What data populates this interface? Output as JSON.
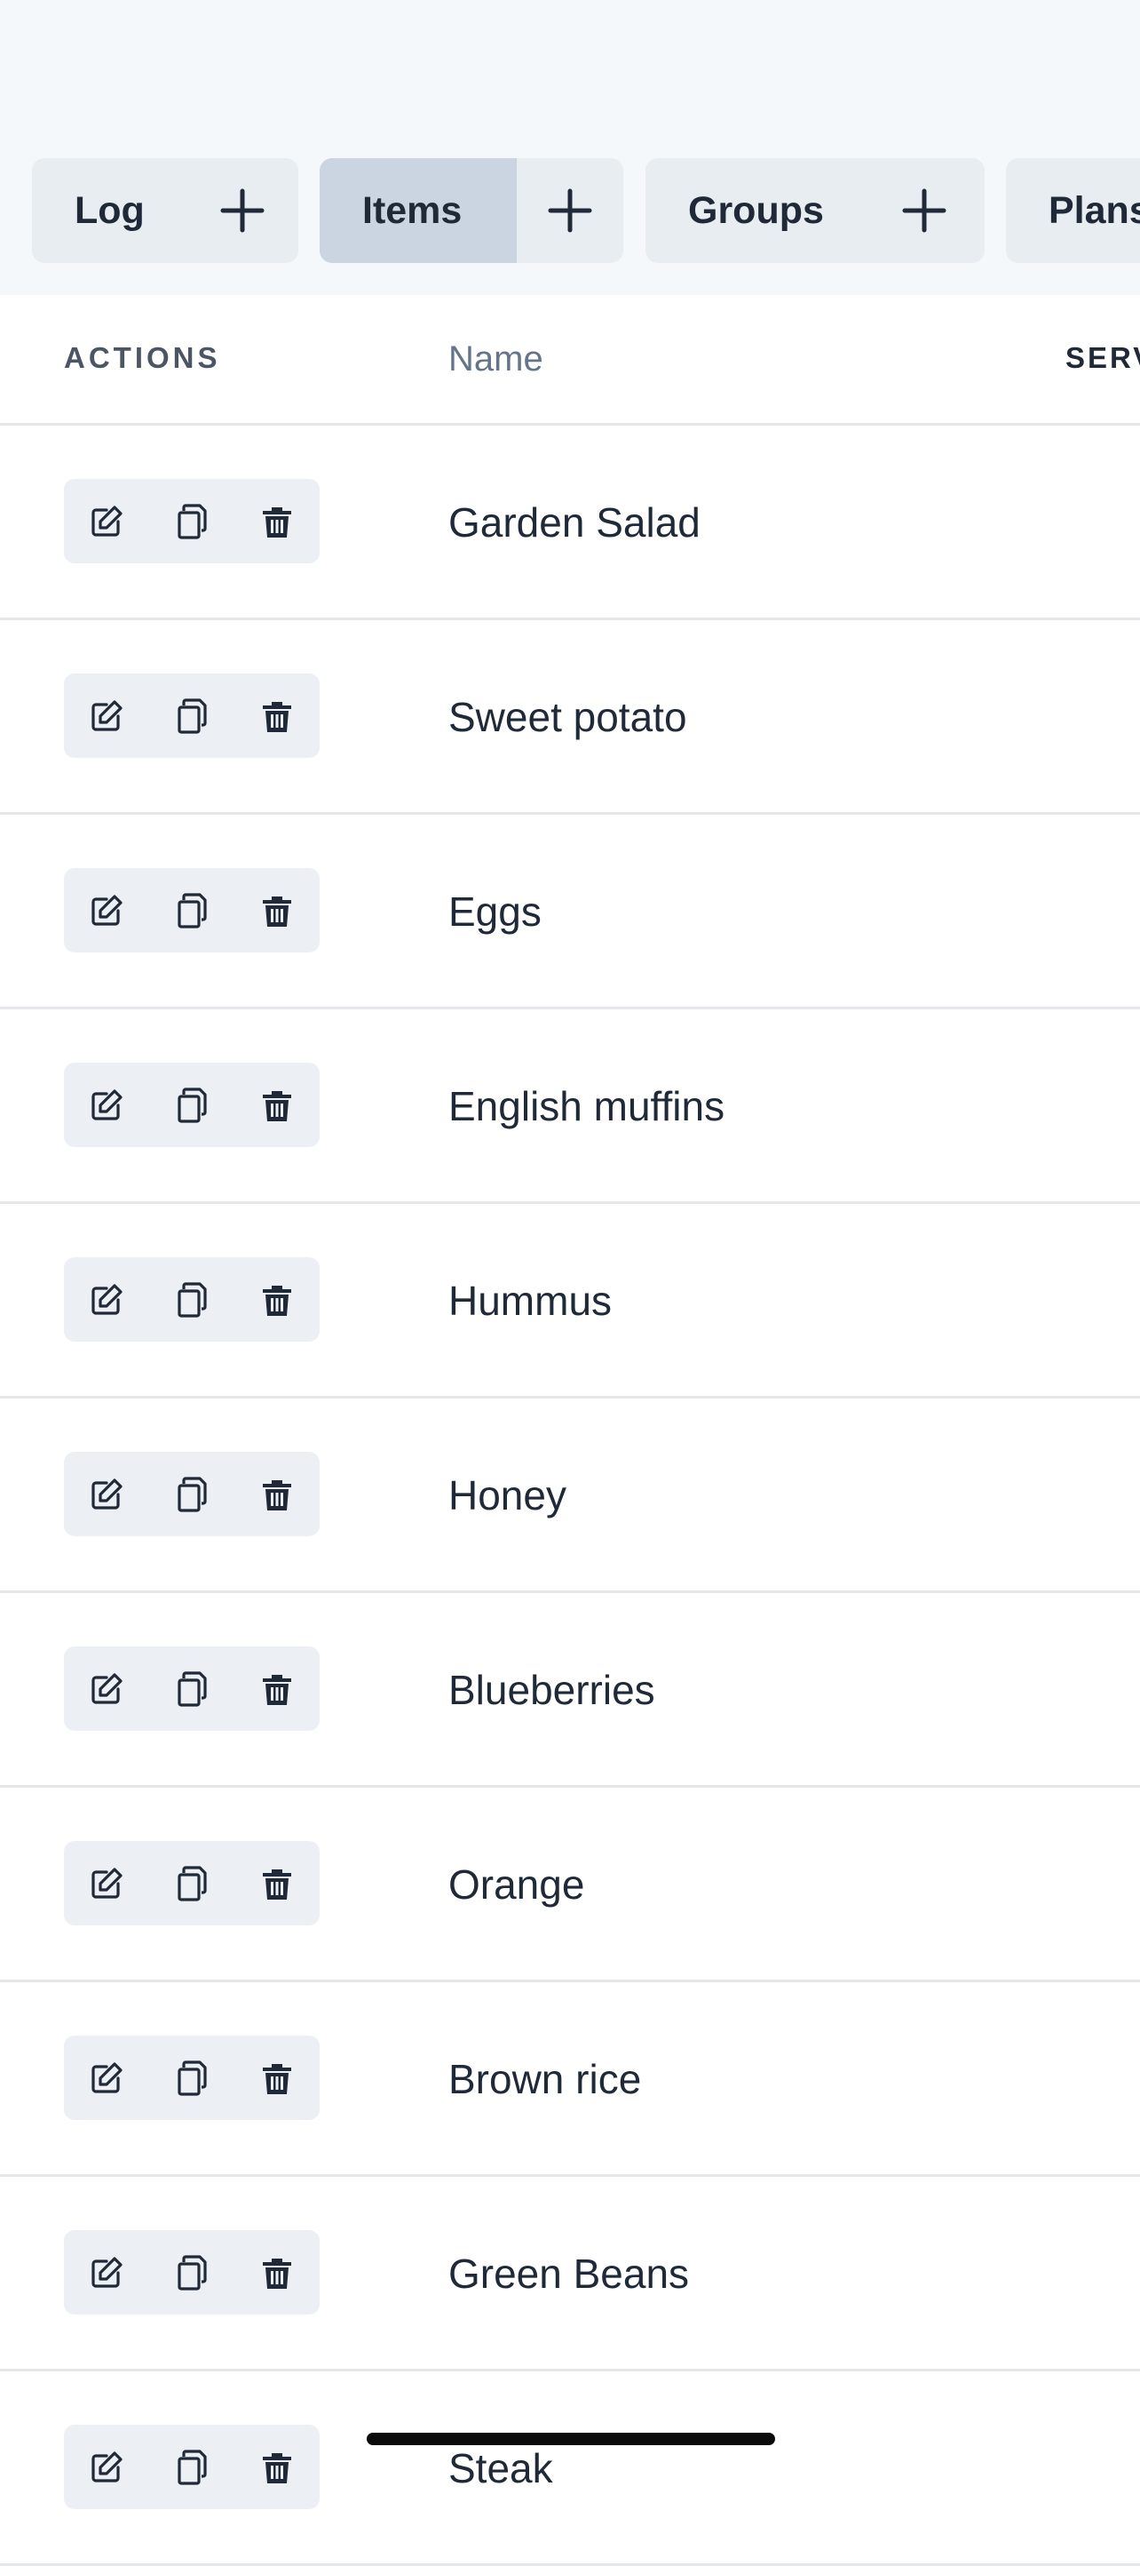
{
  "tabs": [
    {
      "label": "Log",
      "add_icon": "plus-icon",
      "active": false
    },
    {
      "label": "Items",
      "add_icon": "plus-icon",
      "active": true
    },
    {
      "label": "Groups",
      "add_icon": "plus-icon",
      "active": false
    },
    {
      "label": "Plans",
      "active": false
    }
  ],
  "table": {
    "headers": {
      "actions": "ACTIONS",
      "name": "Name",
      "servings": "SERV"
    },
    "row_actions": [
      "edit-icon",
      "copy-icon",
      "trash-icon"
    ],
    "rows": [
      {
        "name": "Garden Salad"
      },
      {
        "name": "Sweet potato"
      },
      {
        "name": "Eggs"
      },
      {
        "name": "English muffins"
      },
      {
        "name": "Hummus"
      },
      {
        "name": "Honey"
      },
      {
        "name": "Blueberries"
      },
      {
        "name": "Orange"
      },
      {
        "name": "Brown rice"
      },
      {
        "name": "Green Beans"
      },
      {
        "name": "Steak"
      }
    ]
  },
  "colors": {
    "header_bg": "#f5f8fb",
    "tab_bg": "#e8edf2",
    "tab_active_bg": "#cbd5e1",
    "action_bg": "#eceff3",
    "text": "#1f2937",
    "muted": "#64748b"
  }
}
